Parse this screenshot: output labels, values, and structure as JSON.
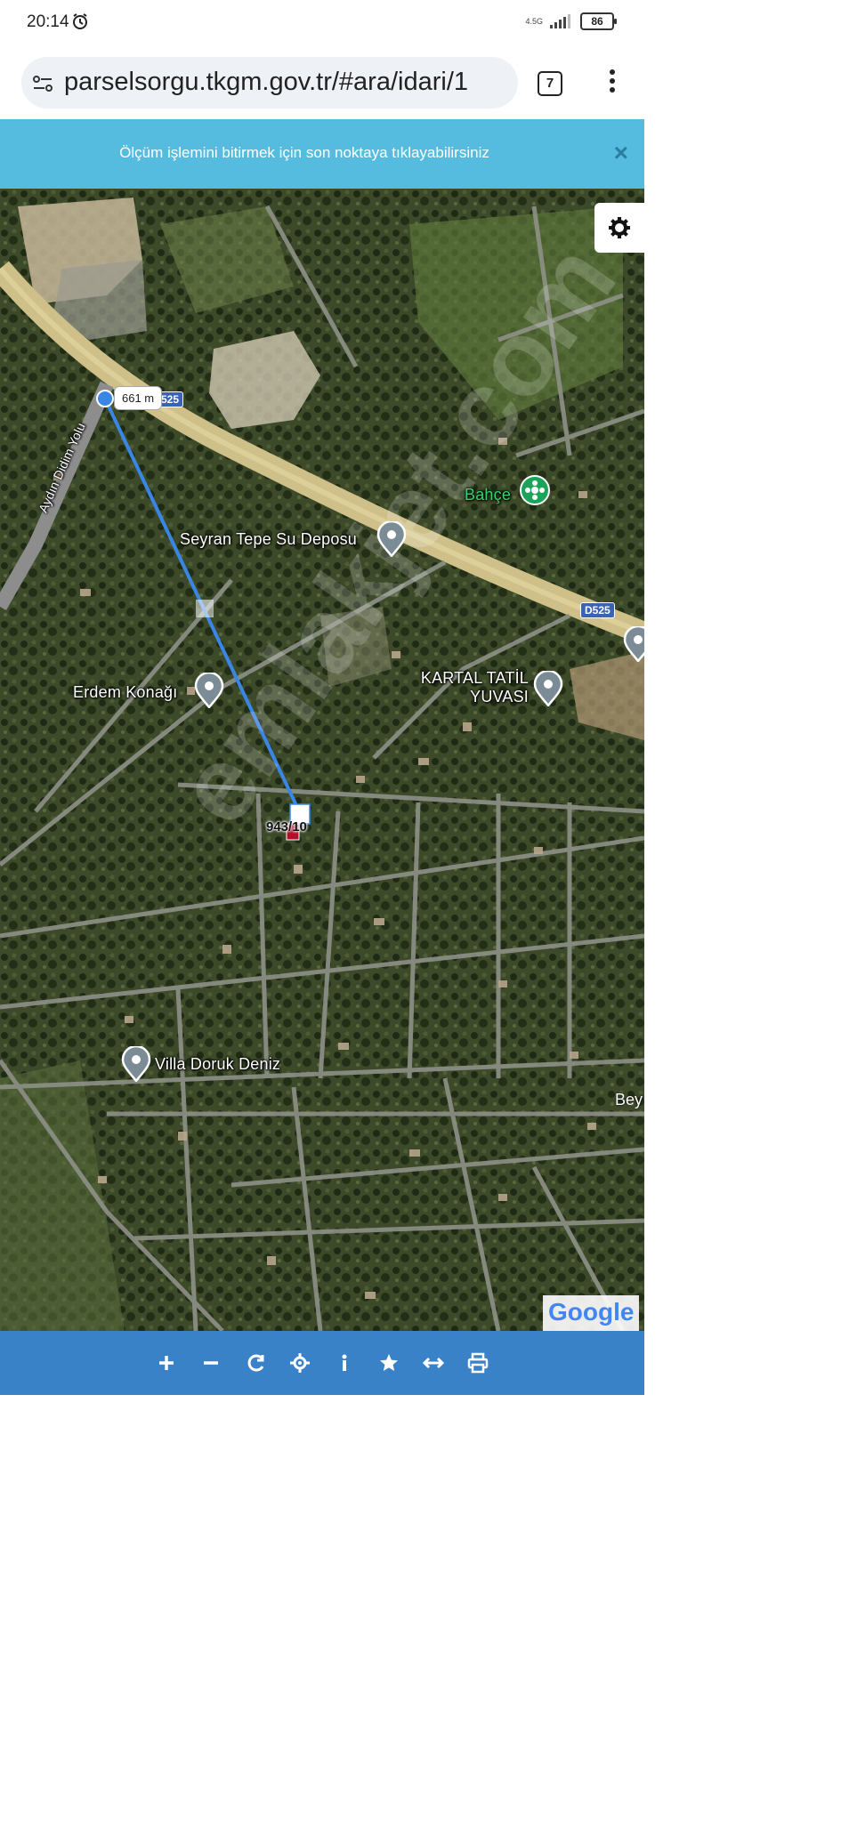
{
  "status": {
    "time": "20:14",
    "network": "4.5G",
    "battery": "86"
  },
  "browser": {
    "url": "parselsorgu.tkgm.gov.tr/#ara/idari/1",
    "tab_count": "7"
  },
  "banner": {
    "message": "Ölçüm işlemini bitirmek için son noktaya tıklayabilirsiniz",
    "close": "×"
  },
  "map": {
    "measurement_label": "661 m",
    "parcel_label": "943/10",
    "road_shields": [
      "525",
      "D525"
    ],
    "road_name": "Aydın Didim Yolu",
    "pois": [
      {
        "name": "Bahçe",
        "icon": "flower-pin-icon"
      },
      {
        "name": "Seyran Tepe Su Deposu",
        "icon": "location-pin-icon"
      },
      {
        "name": "Erdem Konağı",
        "icon": "location-pin-icon"
      },
      {
        "name": "KARTAL TATİL YUVASI",
        "icon": "location-pin-icon"
      },
      {
        "name": "Villa Doruk Deniz",
        "icon": "location-pin-icon"
      }
    ],
    "corner_text": "Bey",
    "watermark": "emlakjet.com",
    "attribution": "Google"
  },
  "toolbar": {
    "tools": [
      "zoom-in",
      "zoom-out",
      "refresh",
      "locate",
      "info",
      "favorite",
      "measure",
      "print"
    ]
  }
}
